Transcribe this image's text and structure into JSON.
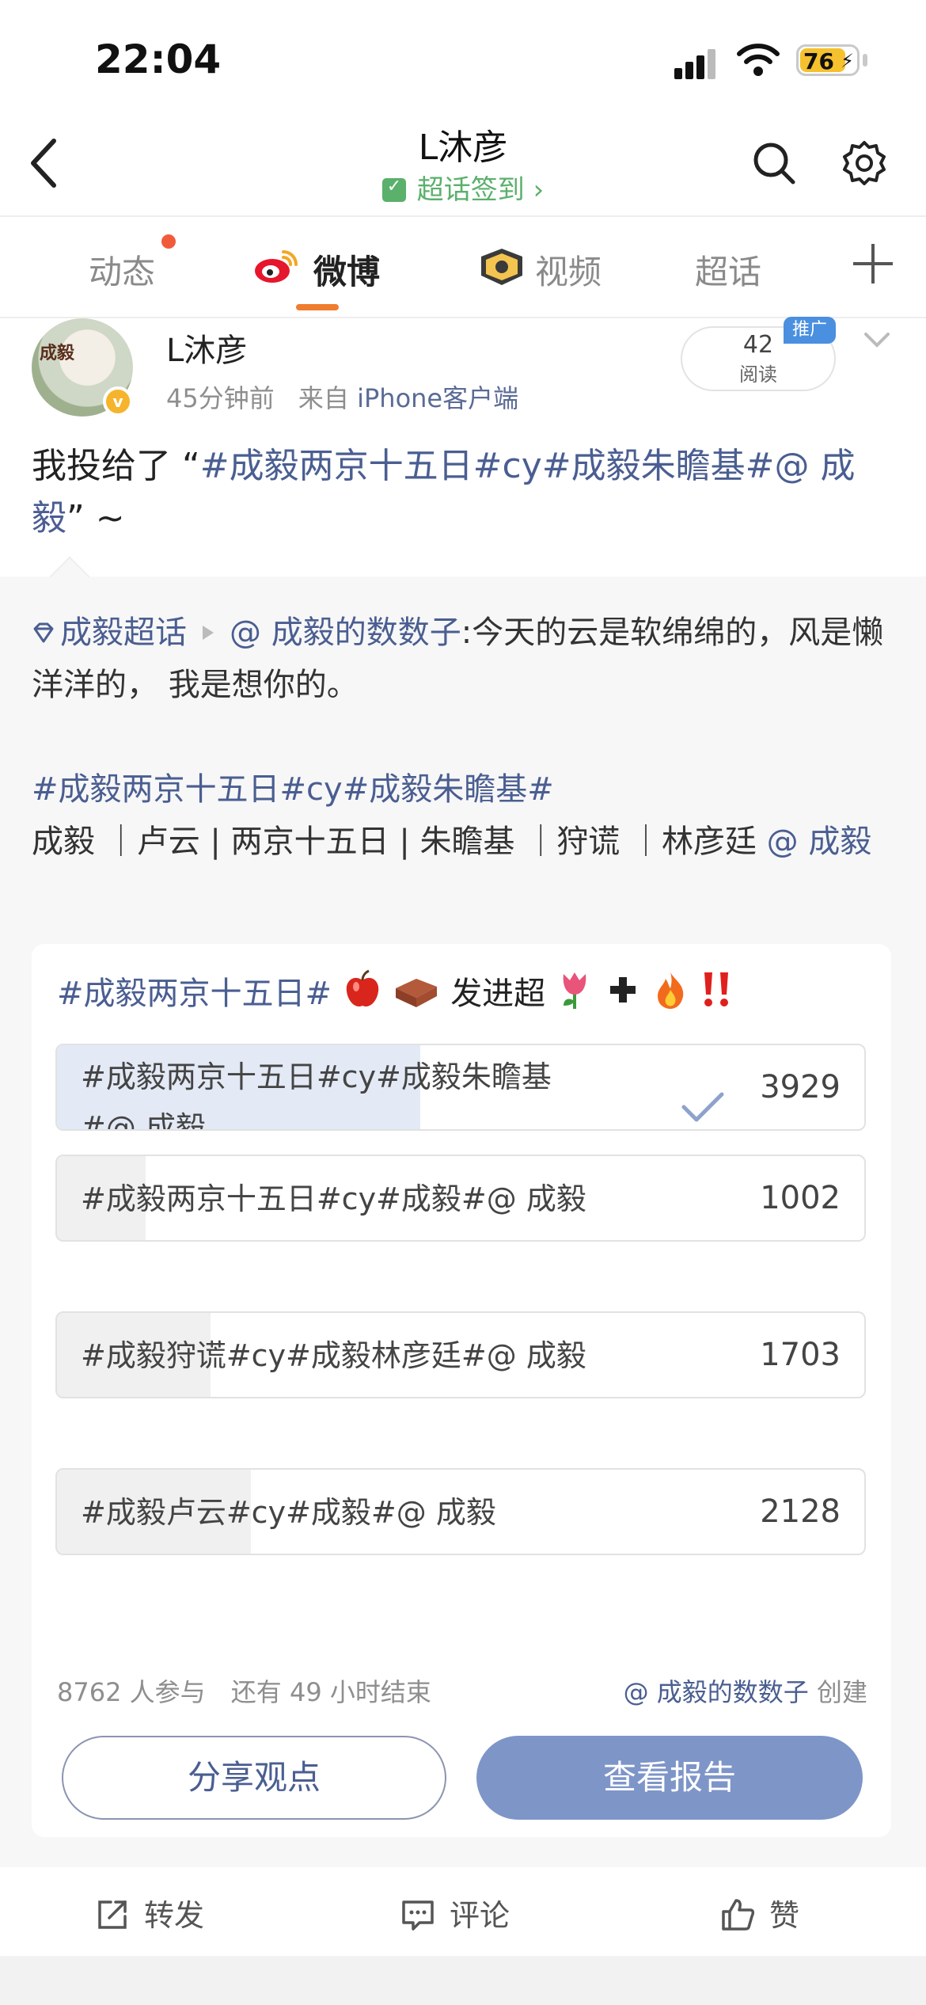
{
  "status_bar": {
    "time": "22:04",
    "battery": "76"
  },
  "header": {
    "title": "L沐彦",
    "subtitle": "超话签到",
    "subtitle_arrow": "›"
  },
  "tabs": [
    {
      "label": "动态",
      "has_dot": true
    },
    {
      "label": "微博",
      "active": true
    },
    {
      "label": "视频"
    },
    {
      "label": "超话"
    }
  ],
  "post": {
    "author": "L沐彦",
    "time": "45分钟前",
    "source_prefix": "来自",
    "source": "iPhone客户端",
    "reads_count": "42",
    "reads_label": "阅读",
    "promo_badge": "推广",
    "text_prefix": "我投给了 “",
    "text_link": "#成毅两京十五日#cy#成毅朱瞻基#@ 成毅",
    "text_suffix": "” ~",
    "avatar_seal": "成毅"
  },
  "repost": {
    "supertopic": "成毅超话",
    "user": "@ 成毅的数数子",
    "content_1": ":今天的云是软绵绵的，风是懒洋洋的， 我是想你的。",
    "hashtags": "#成毅两京十五日#cy#成毅朱瞻基#",
    "tags_line": "成毅 ｜卢云 | 两京十五日 | 朱瞻基 ｜狩谎 ｜林彦廷 ",
    "mention": "@ 成毅"
  },
  "poll": {
    "title_link": "#成毅两京十五日#",
    "title_text": "发进超",
    "options": [
      {
        "label_line1": "#成毅两京十五日#cy#成毅朱瞻基",
        "label_line2": "#@ 成毅",
        "votes": "3929",
        "selected": true,
        "fraction": 0.45
      },
      {
        "label": "#成毅两京十五日#cy#成毅#@ 成毅",
        "votes": "1002",
        "fraction": 0.11
      },
      {
        "label": "#成毅狩谎#cy#成毅林彦廷#@ 成毅",
        "votes": "1703",
        "fraction": 0.19
      },
      {
        "label": "#成毅卢云#cy#成毅#@ 成毅",
        "votes": "2128",
        "fraction": 0.24
      }
    ],
    "participants": "8762 人参与",
    "remaining": "还有 49 小时结束",
    "creator": "@ 成毅的数数子",
    "creator_suffix": "创建",
    "share_button": "分享观点",
    "report_button": "查看报告"
  },
  "actions": {
    "repost": "转发",
    "comment": "评论",
    "like": "赞"
  },
  "colors": {
    "link": "#4a5e91",
    "accent": "#f07c2e",
    "selected_bar": "#e3e9f5",
    "bar": "#f0f0f0",
    "button": "#7e95c8"
  }
}
